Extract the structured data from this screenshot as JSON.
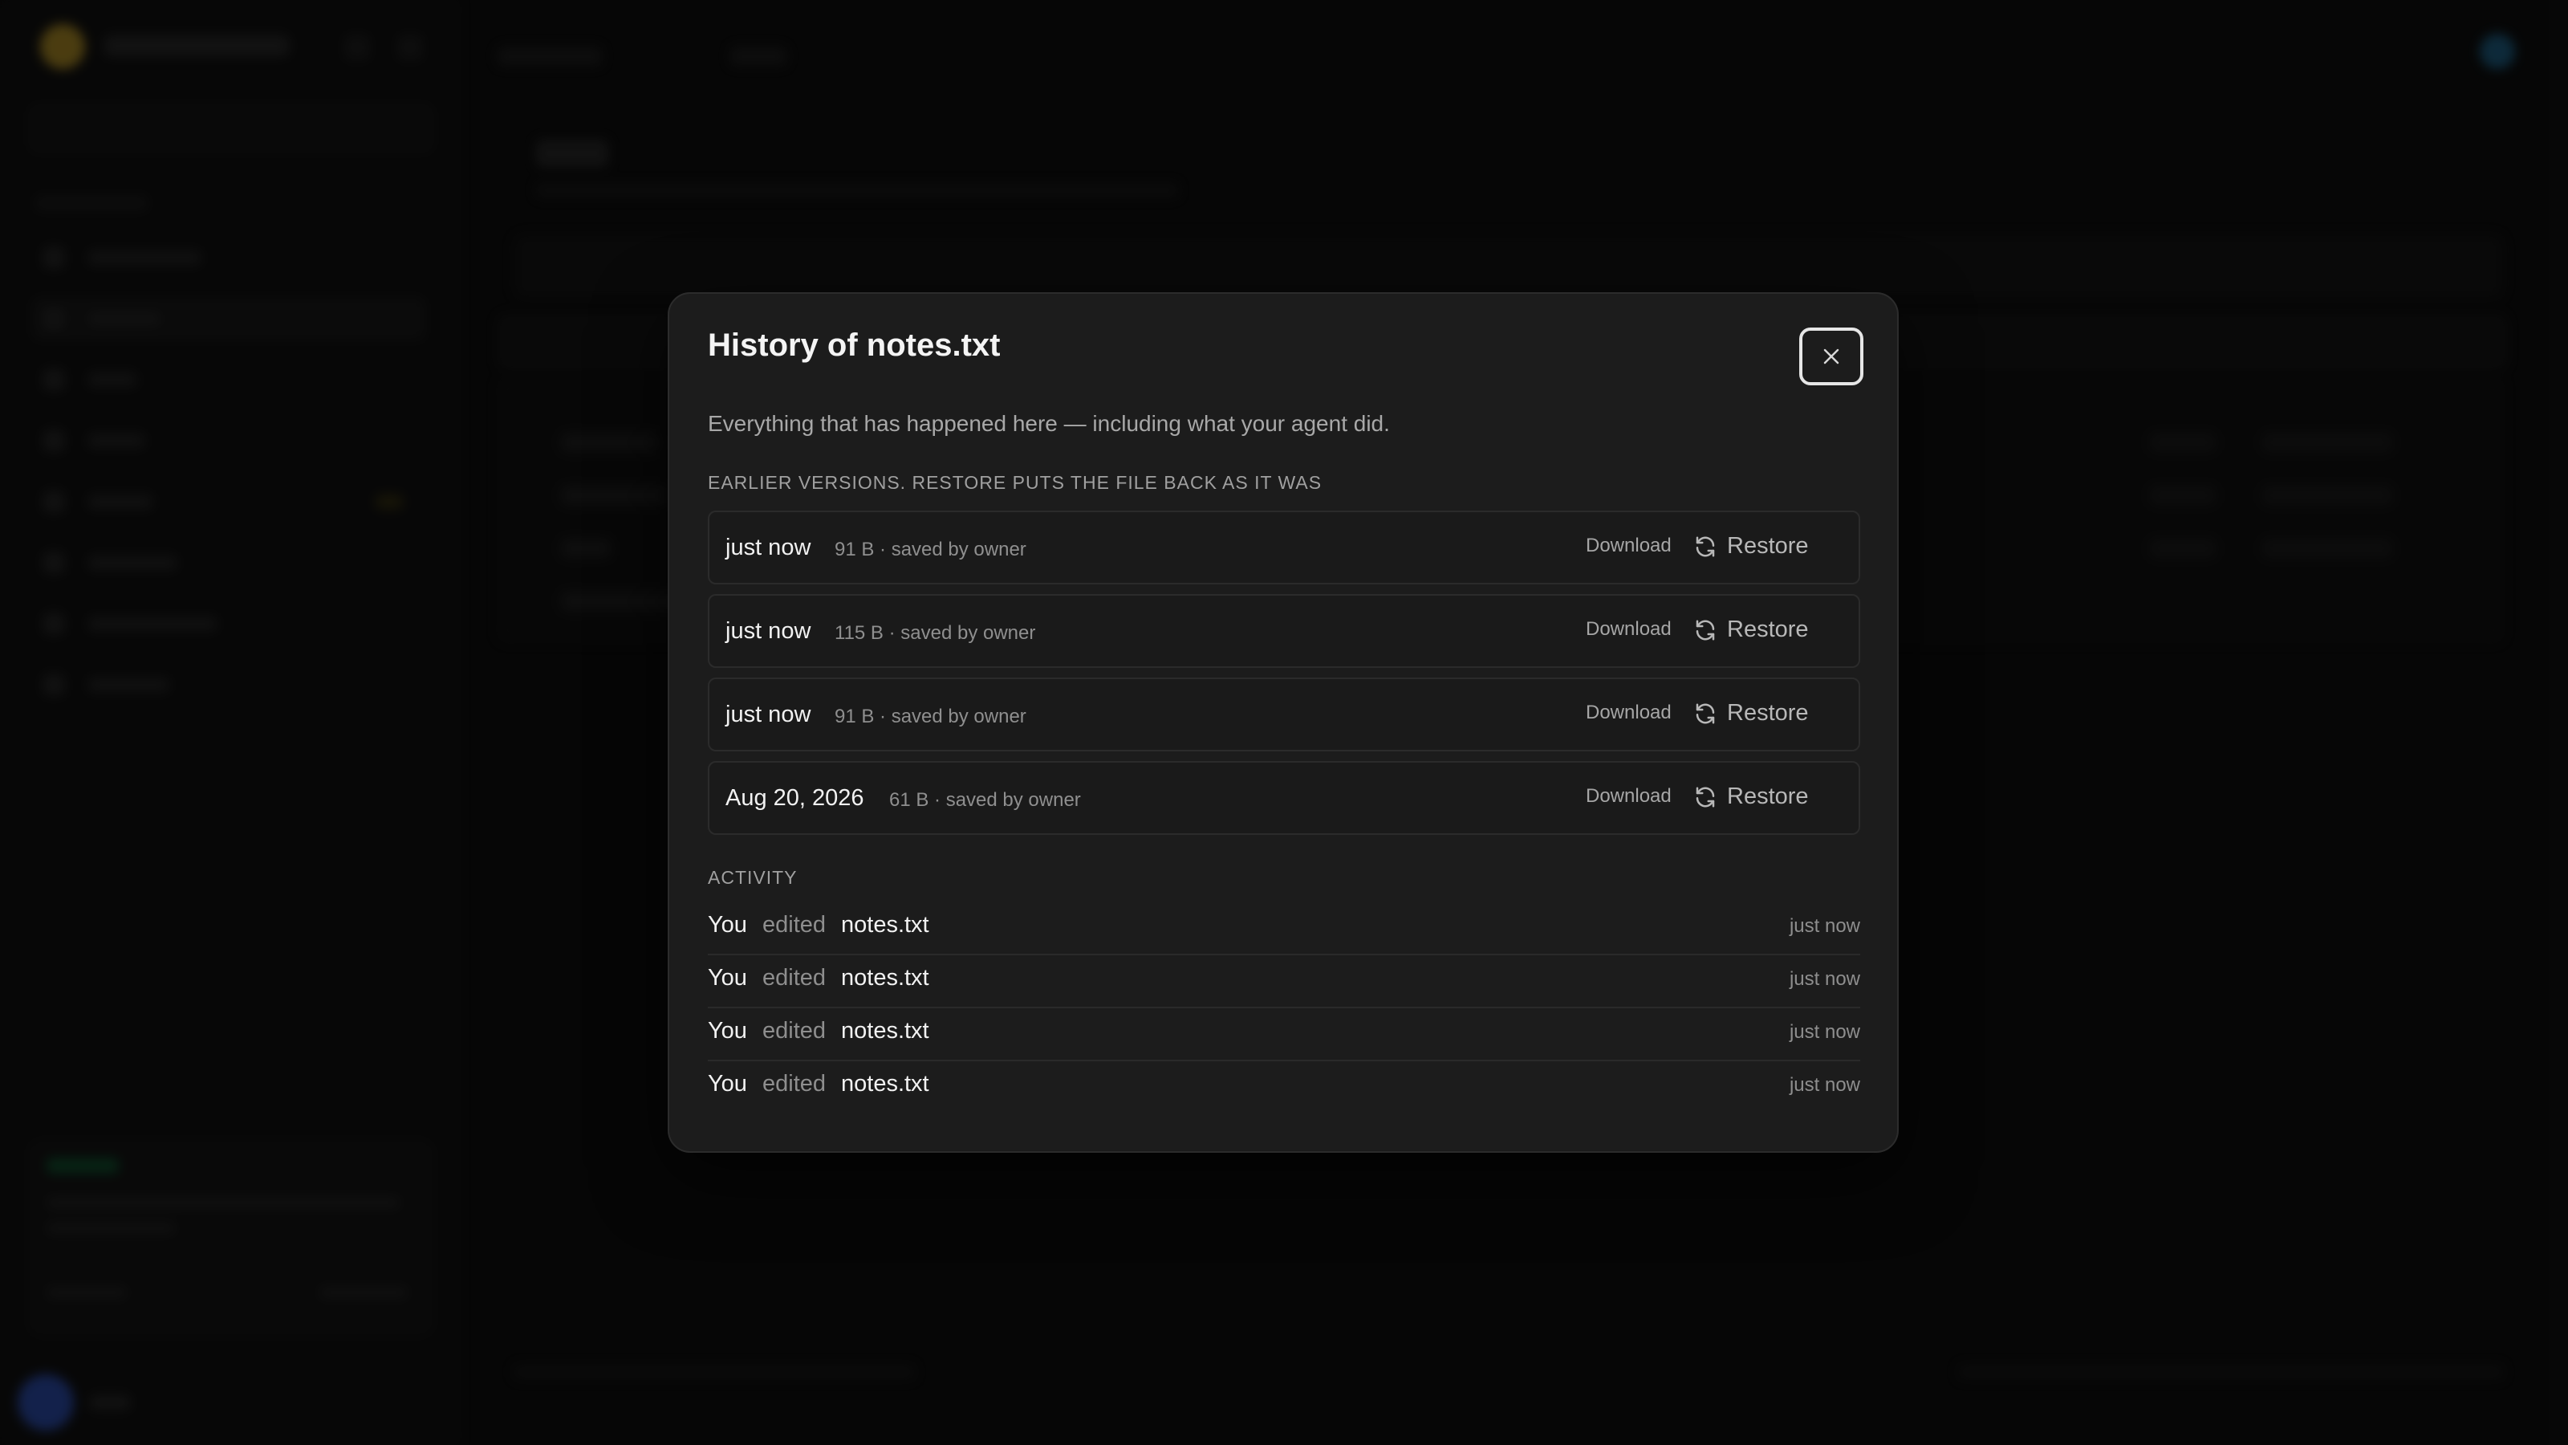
{
  "modal": {
    "title": "History of notes.txt",
    "description": "Everything that has happened here — including what your agent did.",
    "versions_label": "EARLIER VERSIONS. RESTORE PUTS THE FILE BACK AS IT WAS",
    "activity_label": "ACTIVITY",
    "close_icon": "close-icon",
    "versions": [
      {
        "when": "just now",
        "meta": "91 B · saved by owner",
        "download_label": "Download",
        "restore_label": "Restore"
      },
      {
        "when": "just now",
        "meta": "115 B · saved by owner",
        "download_label": "Download",
        "restore_label": "Restore"
      },
      {
        "when": "just now",
        "meta": "91 B · saved by owner",
        "download_label": "Download",
        "restore_label": "Restore"
      },
      {
        "when": "Aug 20, 2026",
        "meta": "61 B · saved by owner",
        "download_label": "Download",
        "restore_label": "Restore"
      }
    ],
    "activity": [
      {
        "who": "You",
        "verb": "edited",
        "file": "notes.txt",
        "time": "just now"
      },
      {
        "who": "You",
        "verb": "edited",
        "file": "notes.txt",
        "time": "just now"
      },
      {
        "who": "You",
        "verb": "edited",
        "file": "notes.txt",
        "time": "just now"
      },
      {
        "who": "You",
        "verb": "edited",
        "file": "notes.txt",
        "time": "just now"
      }
    ]
  },
  "colors": {
    "background": "#0a0a0a",
    "modal_surface": "#1c1c1c",
    "border": "#2c2c2c",
    "text_primary": "#f2f2f2",
    "text_muted": "#8f8f8f"
  }
}
